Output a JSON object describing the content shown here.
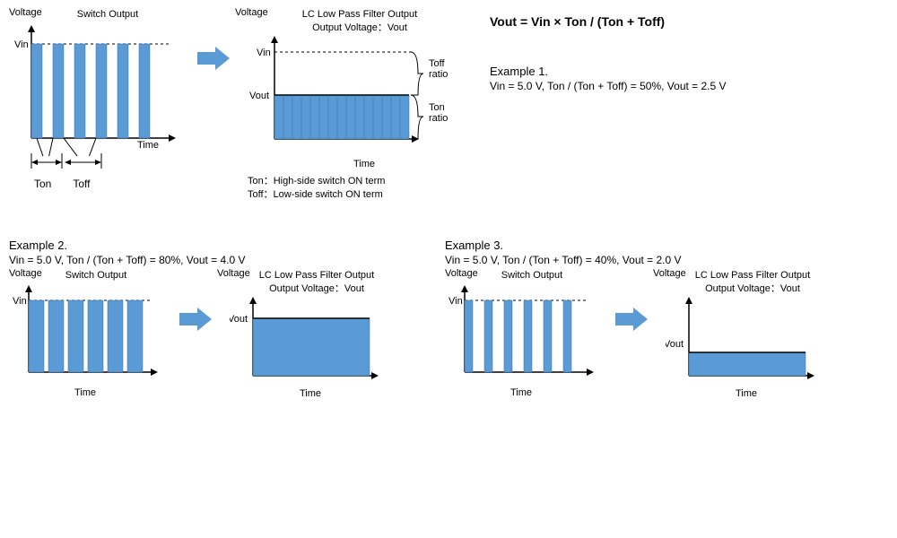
{
  "formula": "Vout = Vin  ×  Ton / (Ton + Toff)",
  "labels": {
    "voltage": "Voltage",
    "time": "Time",
    "vin": "Vin",
    "vout": "Vout",
    "switch_title": "Switch Output",
    "filter_title1": "LC Low Pass Filter Output",
    "filter_title2": "Output Voltage：Vout",
    "toff_ratio": "Toff ratio",
    "ton_ratio": "Ton ratio",
    "ton": "Ton",
    "toff": "Toff",
    "ton_def": "Ton：High-side switch ON term",
    "toff_def": "Toff：Low-side switch ON term"
  },
  "ex1": {
    "head": "Example 1.",
    "body": "Vin = 5.0 V, Ton / (Ton + Toff) = 50%,   Vout = 2.5 V"
  },
  "ex2": {
    "head": "Example 2.",
    "body": "Vin = 5.0 V, Ton / (Ton + Toff) = 80%,   Vout = 4.0 V"
  },
  "ex3": {
    "head": "Example 3.",
    "body": "Vin = 5.0 V, Ton / (Ton + Toff) = 40%,   Vout = 2.0 V"
  },
  "chart_data": [
    {
      "name": "top-switch",
      "type": "bar",
      "duty": 0.5,
      "vin": 5.0,
      "vout": 2.5,
      "periods": 6,
      "title": "Switch Output",
      "xlabel": "Time",
      "ylabel": "Voltage"
    },
    {
      "name": "top-filter",
      "type": "area",
      "duty": 0.5,
      "vin": 5.0,
      "vout": 2.5,
      "title": "LC Low Pass Filter Output / Output Voltage: Vout",
      "xlabel": "Time",
      "ylabel": "Voltage"
    },
    {
      "name": "ex2-switch",
      "type": "bar",
      "duty": 0.8,
      "vin": 5.0,
      "vout": 4.0,
      "periods": 6,
      "title": "Switch Output",
      "xlabel": "Time",
      "ylabel": "Voltage"
    },
    {
      "name": "ex2-filter",
      "type": "area",
      "duty": 0.8,
      "vin": 5.0,
      "vout": 4.0,
      "title": "LC Low Pass Filter Output / Output Voltage: Vout",
      "xlabel": "Time",
      "ylabel": "Voltage"
    },
    {
      "name": "ex3-switch",
      "type": "bar",
      "duty": 0.4,
      "vin": 5.0,
      "vout": 2.0,
      "periods": 6,
      "title": "Switch Output",
      "xlabel": "Time",
      "ylabel": "Voltage"
    },
    {
      "name": "ex3-filter",
      "type": "area",
      "duty": 0.4,
      "vin": 5.0,
      "vout": 2.0,
      "title": "LC Low Pass Filter Output / Output Voltage: Vout",
      "xlabel": "Time",
      "ylabel": "Voltage"
    }
  ],
  "colors": {
    "fill": "#5B9BD5",
    "stroke": "#000"
  }
}
